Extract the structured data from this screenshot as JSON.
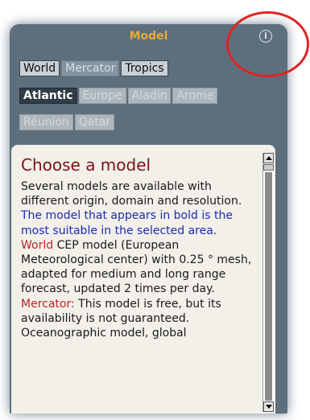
{
  "panel": {
    "title": "Model",
    "info_icon": "info-circle-icon"
  },
  "tabs": {
    "row1": [
      {
        "label": "World",
        "state": "enabled"
      },
      {
        "label": "Mercator",
        "state": "dimmed"
      },
      {
        "label": "Tropics",
        "state": "enabled"
      }
    ],
    "row2": [
      {
        "label": "Atlantic",
        "state": "selected"
      },
      {
        "label": "Europe",
        "state": "disabled"
      },
      {
        "label": "Aladin",
        "state": "disabled"
      },
      {
        "label": "Arome",
        "state": "disabled"
      }
    ],
    "row3": [
      {
        "label": "Réunion",
        "state": "disabled"
      },
      {
        "label": "Qatar",
        "state": "disabled"
      }
    ]
  },
  "content": {
    "title": "Choose a model",
    "intro": "Several models are available with different origin, domain and resolution.",
    "intro_highlight": "The model that appears in bold is the most suitable in the selected area.",
    "world_label": "World",
    "world_text": "CEP model (European Meteorological center) with 0.25 ° mesh, adapted for medium and long range forecast, updated 2 times per day.",
    "mercator_label": "Mercator:",
    "mercator_text": "This model is free, but its availability is not guaranteed. Oceanographic model, global"
  },
  "colors": {
    "panel_bg": "#5d6f7c",
    "title": "#e8a83a",
    "heading": "#7a1212",
    "highlight_blue": "#1b2bb0",
    "model_red": "#b62626",
    "annotation_ring": "#e02323"
  }
}
